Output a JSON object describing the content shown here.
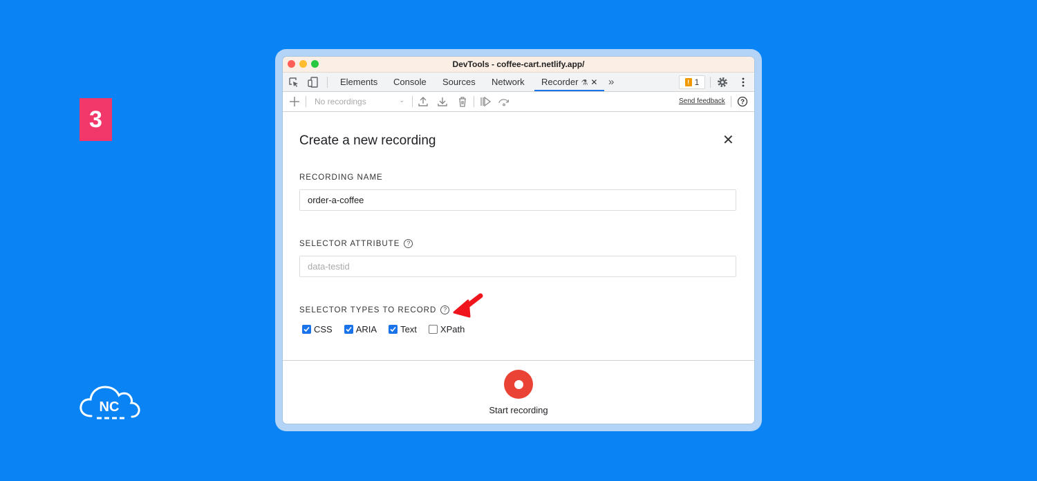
{
  "step": {
    "number": "3",
    "color": "#f2386b"
  },
  "logo": {
    "text": "NC"
  },
  "window": {
    "title": "DevTools - coffee-cart.netlify.app/"
  },
  "tabs": [
    {
      "label": "Elements"
    },
    {
      "label": "Console"
    },
    {
      "label": "Sources"
    },
    {
      "label": "Network"
    },
    {
      "label": "Recorder",
      "active": true
    }
  ],
  "tabbar": {
    "more_icon": "»",
    "issues_count": "1"
  },
  "toolbar": {
    "recordings_select": "No recordings",
    "send_feedback": "Send feedback"
  },
  "dialog": {
    "title": "Create a new recording",
    "recording_name_label": "RECORDING NAME",
    "recording_name_value": "order-a-coffee",
    "selector_attribute_label": "SELECTOR ATTRIBUTE",
    "selector_attribute_placeholder": "data-testid",
    "selector_types_label": "SELECTOR TYPES TO RECORD",
    "selector_types": [
      {
        "label": "CSS",
        "checked": true
      },
      {
        "label": "ARIA",
        "checked": true
      },
      {
        "label": "Text",
        "checked": true
      },
      {
        "label": "XPath",
        "checked": false
      }
    ],
    "start_label": "Start recording"
  },
  "colors": {
    "background": "#0a84f5",
    "accent": "#1a73e8",
    "record": "#ea4335"
  }
}
